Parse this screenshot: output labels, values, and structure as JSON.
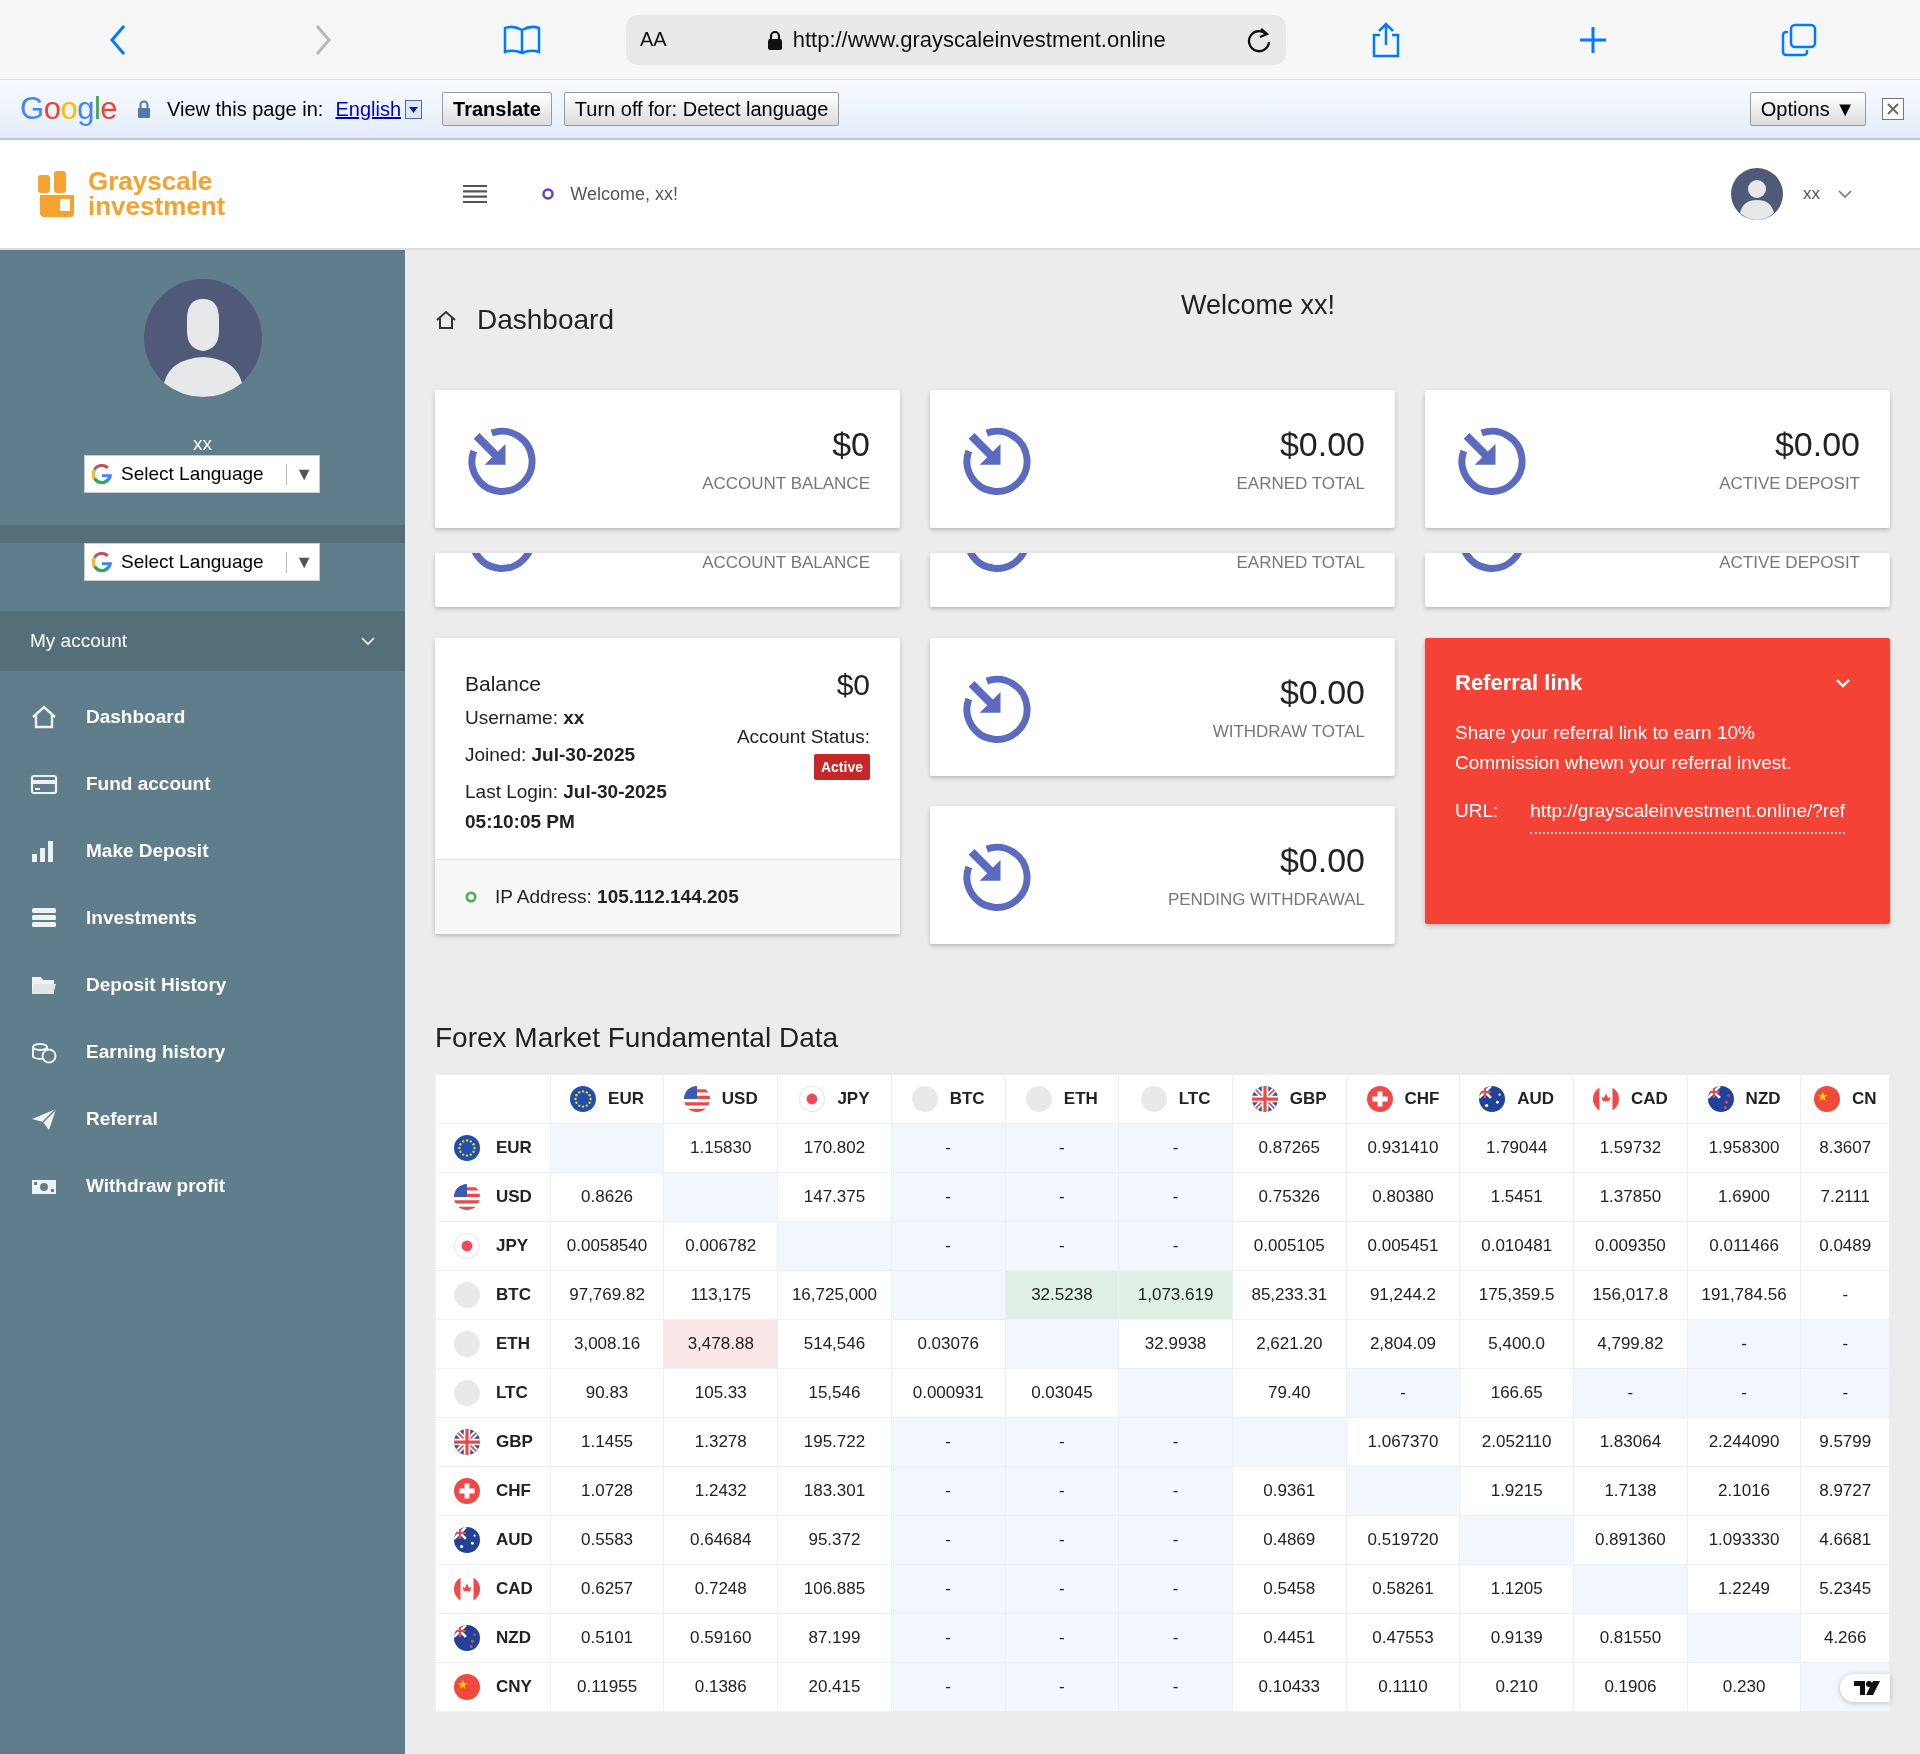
{
  "browser": {
    "text_size_button": "AA",
    "url": "http://www.grayscaleinvestment.online"
  },
  "translate_bar": {
    "logo": "Google",
    "prompt": "View this page in:",
    "language": "English",
    "translate_button": "Translate",
    "turn_off_button": "Turn off for: Detect language",
    "options_button": "Options ▼"
  },
  "header": {
    "logo_line_1": "Grayscale",
    "logo_line_2": "investment",
    "welcome": "Welcome, xx!",
    "user_name": "xx"
  },
  "sidebar": {
    "user_name": "xx",
    "language_selects": [
      {
        "label": "Select Language",
        "caret": "▼"
      },
      {
        "label": "Select Language",
        "caret": "▼"
      }
    ],
    "section": "My account",
    "items": [
      {
        "label": "Dashboard"
      },
      {
        "label": "Fund account"
      },
      {
        "label": "Make Deposit"
      },
      {
        "label": "Investments"
      },
      {
        "label": "Deposit History"
      },
      {
        "label": "Earning history"
      },
      {
        "label": "Referral"
      },
      {
        "label": "Withdraw profit"
      }
    ]
  },
  "page": {
    "title": "Dashboard",
    "welcome": "Welcome xx!"
  },
  "stat_cards": [
    {
      "value": "$0",
      "label": "ACCOUNT BALANCE"
    },
    {
      "value": "$0.00",
      "label": "EARNED TOTAL"
    },
    {
      "value": "$0.00",
      "label": "ACTIVE DEPOSIT"
    }
  ],
  "stat_card_repeats": [
    {
      "label": "ACCOUNT BALANCE"
    },
    {
      "label": "EARNED TOTAL"
    },
    {
      "label": "ACTIVE DEPOSIT"
    }
  ],
  "balance_card": {
    "title": "Balance",
    "amount": "$0",
    "lines": [
      "Username: **xx**",
      "Joined: **Jul-30-2025**",
      "Last Login: **Jul-30-2025 05:10:05 PM**"
    ],
    "status_label": "Account Status:",
    "status": "Active",
    "ip": "IP Address: **105.112.144.205**"
  },
  "withdraw_cards": [
    {
      "value": "$0.00",
      "label": "WITHDRAW TOTAL"
    },
    {
      "value": "$0.00",
      "label": "PENDING WITHDRAWAL"
    }
  ],
  "referral": {
    "title": "Referral link",
    "text": "Share your referral link to earn 10% Commission whewn your referral invest.",
    "url_label": "URL:",
    "url": "http://grayscaleinvestment.online/?ref"
  },
  "forex": {
    "title": "Forex Market Fundamental Data",
    "columns": [
      "EUR",
      "USD",
      "JPY",
      "BTC",
      "ETH",
      "LTC",
      "GBP",
      "CHF",
      "AUD",
      "CAD",
      "NZD",
      "CN"
    ],
    "rows": [
      {
        "currency": "EUR",
        "cells": [
          {
            "color": "#f3f6fd"
          },
          {
            "value": "1.15830",
            "color": "#ffffff"
          },
          {
            "value": "170.802",
            "color": "#ffffff"
          },
          {
            "value": "-",
            "color": "#f3f6fd"
          },
          {
            "value": "-",
            "color": "#f3f6fd"
          },
          {
            "value": "-",
            "color": "#f3f6fd"
          },
          {
            "value": "0.87265",
            "color": "#ffffff"
          },
          {
            "value": "0.931410",
            "color": "#ffffff"
          },
          {
            "value": "1.79044",
            "color": "#ffffff"
          },
          {
            "value": "1.59732",
            "color": "#ffffff"
          },
          {
            "value": "1.958300",
            "color": "#ffffff"
          },
          {
            "value": "8.3607",
            "color": "#ffffff"
          }
        ]
      },
      {
        "currency": "USD",
        "cells": [
          {
            "value": "0.8626",
            "color": "#ffffff"
          },
          {
            "color": "#f3f6fd"
          },
          {
            "value": "147.375",
            "color": "#ffffff"
          },
          {
            "value": "-",
            "color": "#f3f6fd"
          },
          {
            "value": "-",
            "color": "#f3f6fd"
          },
          {
            "value": "-",
            "color": "#f3f6fd"
          },
          {
            "value": "0.75326",
            "color": "#ffffff"
          },
          {
            "value": "0.80380",
            "color": "#ffffff"
          },
          {
            "value": "1.5451",
            "color": "#ffffff"
          },
          {
            "value": "1.37850",
            "color": "#ffffff"
          },
          {
            "value": "1.6900",
            "color": "#ffffff"
          },
          {
            "value": "7.2111",
            "color": "#ffffff"
          }
        ]
      },
      {
        "currency": "JPY",
        "cells": [
          {
            "value": "0.0058540",
            "color": "#ffffff"
          },
          {
            "value": "0.006782",
            "color": "#ffffff"
          },
          {
            "color": "#f3f6fd"
          },
          {
            "value": "-",
            "color": "#f3f6fd"
          },
          {
            "value": "-",
            "color": "#f3f6fd"
          },
          {
            "value": "-",
            "color": "#f3f6fd"
          },
          {
            "value": "0.005105",
            "color": "#ffffff"
          },
          {
            "value": "0.005451",
            "color": "#ffffff"
          },
          {
            "value": "0.010481",
            "color": "#ffffff"
          },
          {
            "value": "0.009350",
            "color": "#ffffff"
          },
          {
            "value": "0.011466",
            "color": "#ffffff"
          },
          {
            "value": "0.0489",
            "color": "#ffffff"
          }
        ]
      },
      {
        "currency": "BTC",
        "cells": [
          {
            "value": "97,769.82",
            "color": "#ffffff"
          },
          {
            "value": "113,175",
            "color": "#ffffff"
          },
          {
            "value": "16,725,000",
            "color": "#ffffff"
          },
          {
            "color": "#f3f6fd"
          },
          {
            "value": "32.5238",
            "color": "#dff1e4"
          },
          {
            "value": "1,073.619",
            "color": "#dff1e4"
          },
          {
            "value": "85,233.31",
            "color": "#ffffff"
          },
          {
            "value": "91,244.2",
            "color": "#ffffff"
          },
          {
            "value": "175,359.5",
            "color": "#ffffff"
          },
          {
            "value": "156,017.8",
            "color": "#ffffff"
          },
          {
            "value": "191,784.56",
            "color": "#ffffff"
          },
          {
            "value": "-",
            "color": "#ffffff"
          }
        ]
      },
      {
        "currency": "ETH",
        "cells": [
          {
            "value": "3,008.16",
            "color": "#ffffff"
          },
          {
            "value": "3,478.88",
            "color": "#fbe7e9"
          },
          {
            "value": "514,546",
            "color": "#ffffff"
          },
          {
            "value": "0.03076",
            "color": "#ffffff"
          },
          {
            "color": "#f3f6fd"
          },
          {
            "value": "32.9938",
            "color": "#ffffff"
          },
          {
            "value": "2,621.20",
            "color": "#ffffff"
          },
          {
            "value": "2,804.09",
            "color": "#ffffff"
          },
          {
            "value": "5,400.0",
            "color": "#ffffff"
          },
          {
            "value": "4,799.82",
            "color": "#ffffff"
          },
          {
            "value": "-",
            "color": "#f3f6fd"
          },
          {
            "value": "-",
            "color": "#f3f6fd"
          }
        ]
      },
      {
        "currency": "LTC",
        "cells": [
          {
            "value": "90.83",
            "color": "#ffffff"
          },
          {
            "value": "105.33",
            "color": "#ffffff"
          },
          {
            "value": "15,546",
            "color": "#ffffff"
          },
          {
            "value": "0.000931",
            "color": "#ffffff"
          },
          {
            "value": "0.03045",
            "color": "#ffffff"
          },
          {
            "color": "#f3f6fd"
          },
          {
            "value": "79.40",
            "color": "#ffffff"
          },
          {
            "value": "-",
            "color": "#f3f6fd"
          },
          {
            "value": "166.65",
            "color": "#ffffff"
          },
          {
            "value": "-",
            "color": "#f3f6fd"
          },
          {
            "value": "-",
            "color": "#f3f6fd"
          },
          {
            "value": "-",
            "color": "#f3f6fd"
          }
        ]
      },
      {
        "currency": "GBP",
        "cells": [
          {
            "value": "1.1455",
            "color": "#ffffff"
          },
          {
            "value": "1.3278",
            "color": "#ffffff"
          },
          {
            "value": "195.722",
            "color": "#ffffff"
          },
          {
            "value": "-",
            "color": "#f3f6fd"
          },
          {
            "value": "-",
            "color": "#f3f6fd"
          },
          {
            "value": "-",
            "color": "#f3f6fd"
          },
          {
            "color": "#f3f6fd"
          },
          {
            "value": "1.067370",
            "color": "#ffffff"
          },
          {
            "value": "2.052110",
            "color": "#ffffff"
          },
          {
            "value": "1.83064",
            "color": "#ffffff"
          },
          {
            "value": "2.244090",
            "color": "#ffffff"
          },
          {
            "value": "9.5799",
            "color": "#ffffff"
          }
        ]
      },
      {
        "currency": "CHF",
        "cells": [
          {
            "value": "1.0728",
            "color": "#ffffff"
          },
          {
            "value": "1.2432",
            "color": "#ffffff"
          },
          {
            "value": "183.301",
            "color": "#ffffff"
          },
          {
            "value": "-",
            "color": "#f3f6fd"
          },
          {
            "value": "-",
            "color": "#f3f6fd"
          },
          {
            "value": "-",
            "color": "#f3f6fd"
          },
          {
            "value": "0.9361",
            "color": "#ffffff"
          },
          {
            "color": "#f3f6fd"
          },
          {
            "value": "1.9215",
            "color": "#ffffff"
          },
          {
            "value": "1.7138",
            "color": "#ffffff"
          },
          {
            "value": "2.1016",
            "color": "#ffffff"
          },
          {
            "value": "8.9727",
            "color": "#ffffff"
          }
        ]
      },
      {
        "currency": "AUD",
        "cells": [
          {
            "value": "0.5583",
            "color": "#ffffff"
          },
          {
            "value": "0.64684",
            "color": "#ffffff"
          },
          {
            "value": "95.372",
            "color": "#ffffff"
          },
          {
            "value": "-",
            "color": "#f3f6fd"
          },
          {
            "value": "-",
            "color": "#f3f6fd"
          },
          {
            "value": "-",
            "color": "#f3f6fd"
          },
          {
            "value": "0.4869",
            "color": "#ffffff"
          },
          {
            "value": "0.519720",
            "color": "#ffffff"
          },
          {
            "color": "#f3f6fd"
          },
          {
            "value": "0.891360",
            "color": "#ffffff"
          },
          {
            "value": "1.093330",
            "color": "#ffffff"
          },
          {
            "value": "4.6681",
            "color": "#ffffff"
          }
        ]
      },
      {
        "currency": "CAD",
        "cells": [
          {
            "value": "0.6257",
            "color": "#ffffff"
          },
          {
            "value": "0.7248",
            "color": "#ffffff"
          },
          {
            "value": "106.885",
            "color": "#ffffff"
          },
          {
            "value": "-",
            "color": "#f3f6fd"
          },
          {
            "value": "-",
            "color": "#f3f6fd"
          },
          {
            "value": "-",
            "color": "#f3f6fd"
          },
          {
            "value": "0.5458",
            "color": "#ffffff"
          },
          {
            "value": "0.58261",
            "color": "#ffffff"
          },
          {
            "value": "1.1205",
            "color": "#ffffff"
          },
          {
            "color": "#f3f6fd"
          },
          {
            "value": "1.2249",
            "color": "#ffffff"
          },
          {
            "value": "5.2345",
            "color": "#ffffff"
          }
        ]
      },
      {
        "currency": "NZD",
        "cells": [
          {
            "value": "0.5101",
            "color": "#ffffff"
          },
          {
            "value": "0.59160",
            "color": "#ffffff"
          },
          {
            "value": "87.199",
            "color": "#ffffff"
          },
          {
            "value": "-",
            "color": "#f3f6fd"
          },
          {
            "value": "-",
            "color": "#f3f6fd"
          },
          {
            "value": "-",
            "color": "#f3f6fd"
          },
          {
            "value": "0.4451",
            "color": "#ffffff"
          },
          {
            "value": "0.47553",
            "color": "#ffffff"
          },
          {
            "value": "0.9139",
            "color": "#ffffff"
          },
          {
            "value": "0.81550",
            "color": "#ffffff"
          },
          {
            "color": "#f3f6fd"
          },
          {
            "value": "4.266",
            "color": "#ffffff"
          }
        ]
      },
      {
        "currency": "CNY",
        "cells": [
          {
            "value": "0.11955",
            "color": "#ffffff"
          },
          {
            "value": "0.1386",
            "color": "#ffffff"
          },
          {
            "value": "20.415",
            "color": "#ffffff"
          },
          {
            "value": "-",
            "color": "#f3f6fd"
          },
          {
            "value": "-",
            "color": "#f3f6fd"
          },
          {
            "value": "-",
            "color": "#f3f6fd"
          },
          {
            "value": "0.10433",
            "color": "#ffffff"
          },
          {
            "value": "0.1110",
            "color": "#ffffff"
          },
          {
            "value": "0.210",
            "color": "#ffffff"
          },
          {
            "value": "0.1906",
            "color": "#ffffff"
          },
          {
            "value": "0.230",
            "color": "#ffffff"
          },
          {
            "color": "#f3f6fd"
          }
        ]
      }
    ]
  }
}
